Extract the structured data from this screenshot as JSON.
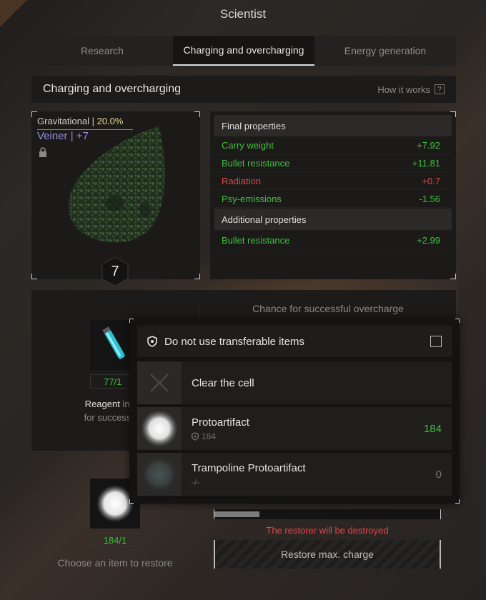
{
  "window": {
    "title": "Scientist"
  },
  "tabs": [
    {
      "label": "Research",
      "active": false
    },
    {
      "label": "Charging and overcharging",
      "active": true
    },
    {
      "label": "Energy generation",
      "active": false
    }
  ],
  "section": {
    "title": "Charging and overcharging",
    "how_it_works": "How it works",
    "help_glyph": "?"
  },
  "artifact": {
    "type": "Gravitational",
    "separator": " | ",
    "percent": "20.0%",
    "name": "Veiner",
    "name_sep": " | ",
    "upgrade": "+7",
    "level": "7",
    "locked": true
  },
  "final_properties": {
    "title": "Final properties",
    "rows": [
      {
        "label": "Carry weight",
        "value": "+7.92",
        "status": "green"
      },
      {
        "label": "Bullet resistance",
        "value": "+11.81",
        "status": "green"
      },
      {
        "label": "Radiation",
        "value": "+0.7",
        "status": "red"
      },
      {
        "label": "Psy-emissions",
        "value": "-1.56",
        "status": "green"
      }
    ]
  },
  "additional_properties": {
    "title": "Additional properties",
    "rows": [
      {
        "label": "Bullet resistance",
        "value": "+2.99",
        "status": "green"
      }
    ]
  },
  "overcharge": {
    "chance_label": "Chance for successful overcharge",
    "reagent_count": "77/1",
    "reagent_text_bold": "Reagent",
    "reagent_text_1": " increas",
    "reagent_text_2": "for successful ov"
  },
  "restore": {
    "count": "184/1",
    "caption": "Choose an item to restore",
    "progress": 0.2,
    "warning": "The restorer will be destroyed",
    "button": "Restore max. charge"
  },
  "popup": {
    "header": "Do not use transferable items",
    "checked": false,
    "items": [
      {
        "name": "Clear the cell",
        "sub": "",
        "qty": "",
        "icon": "close-icon"
      },
      {
        "name": "Protoartifact",
        "sub": "184",
        "qty": "184",
        "qty_color": "green",
        "icon": "protoartifact-icon"
      },
      {
        "name": "Trampoline Protoartifact",
        "sub": "-/-",
        "qty": "0",
        "qty_color": "grey",
        "icon": "trampoline-protoartifact-icon"
      }
    ]
  },
  "colors": {
    "green": "#3cc23c",
    "red": "#e04848",
    "accent_yellow": "#e2d98a",
    "name_purple": "#8f8fe0"
  }
}
